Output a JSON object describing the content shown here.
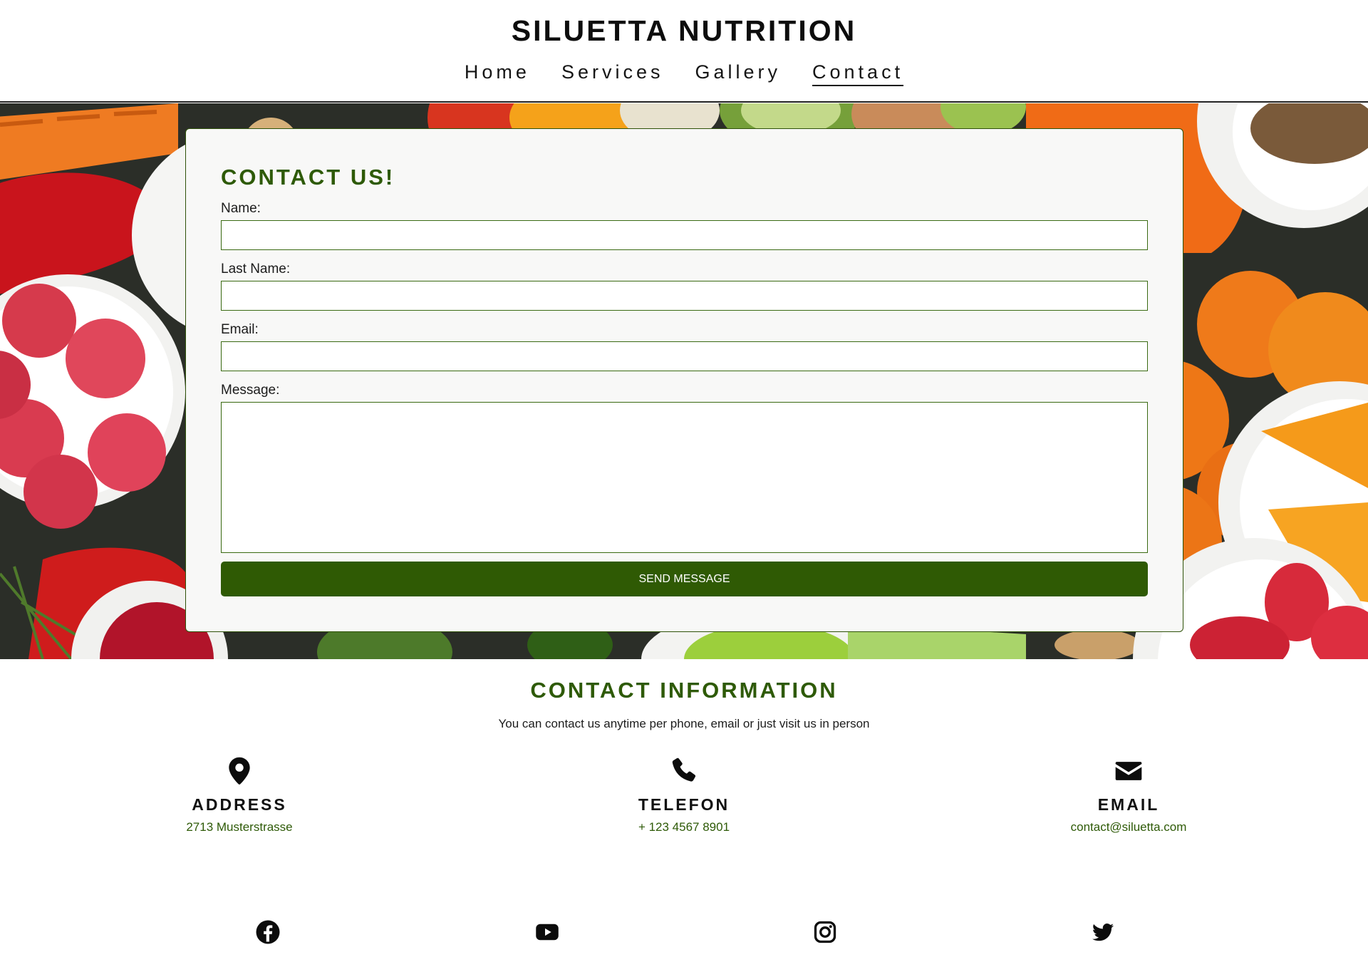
{
  "brand": "SILUETTA NUTRITION",
  "nav": [
    {
      "label": "Home"
    },
    {
      "label": "Services"
    },
    {
      "label": "Gallery"
    },
    {
      "label": "Contact"
    }
  ],
  "active_nav": "Contact",
  "form": {
    "title": "CONTACT US!",
    "name_label": "Name:",
    "name_value": "",
    "lastname_label": "Last Name:",
    "lastname_value": "",
    "email_label": "Email:",
    "email_value": "",
    "message_label": "Message:",
    "message_value": "",
    "submit_label": "SEND MESSAGE"
  },
  "contact_info": {
    "title": "CONTACT INFORMATION",
    "subtitle": "You can contact us anytime per phone, email or just visit us in person",
    "items": [
      {
        "icon": "map-pin-icon",
        "title": "ADDRESS",
        "value": "2713 Musterstrasse"
      },
      {
        "icon": "phone-icon",
        "title": "TELEFON",
        "value": "+ 123 4567 8901"
      },
      {
        "icon": "envelope-icon",
        "title": "EMAIL",
        "value": "contact@siluetta.com"
      }
    ]
  },
  "social": [
    "facebook-icon",
    "youtube-icon",
    "instagram-icon",
    "twitter-icon"
  ],
  "colors": {
    "accent": "#2e5a07",
    "button": "#2f5a04",
    "card_bg": "#f8f8f7"
  }
}
